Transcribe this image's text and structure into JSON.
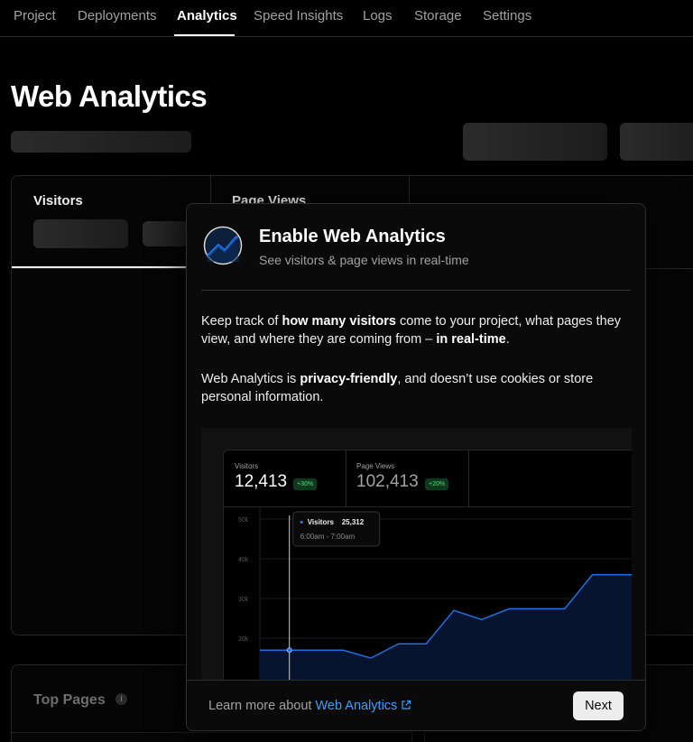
{
  "nav": {
    "tabs": [
      {
        "label": "Project"
      },
      {
        "label": "Deployments"
      },
      {
        "label": "Analytics"
      },
      {
        "label": "Speed Insights"
      },
      {
        "label": "Logs"
      },
      {
        "label": "Storage"
      },
      {
        "label": "Settings"
      }
    ],
    "active": "Analytics"
  },
  "page": {
    "title": "Web Analytics"
  },
  "stats": {
    "visitors_label": "Visitors",
    "pageviews_label": "Page Views"
  },
  "top_pages": {
    "title": "Top Pages",
    "info_glyph": "i"
  },
  "modal": {
    "title": "Enable Web Analytics",
    "subtitle": "See visitors & page views in real-time",
    "p1_a": "Keep track of ",
    "p1_b": "how many visitors",
    "p1_c": " come to your project, what pages they view, and where they are coming from – ",
    "p1_d": "in real-time",
    "p1_e": ".",
    "p2_a": "Web Analytics is ",
    "p2_b": "privacy-friendly",
    "p2_c": ", and doesn’t use cookies or store personal information.",
    "learn_prefix": "Learn more about ",
    "learn_link": "Web Analytics",
    "next_label": "Next",
    "accent": "#3b9eff"
  },
  "preview": {
    "visitors_label": "Visitors",
    "visitors_value": "12,413",
    "visitors_change": "+30%",
    "pageviews_label": "Page Views",
    "pageviews_value": "102,413",
    "pageviews_change": "+20%",
    "tooltip_series": "Visitors",
    "tooltip_value": "25,312",
    "tooltip_time": "6:00am - 7:00am",
    "line_color": "#1f6fe5"
  },
  "chart_data": {
    "type": "area",
    "title": "",
    "xlabel": "",
    "ylabel": "",
    "y_ticks": [
      "50k",
      "40k",
      "30k",
      "20k"
    ],
    "ylim": [
      10000,
      50000
    ],
    "series": [
      {
        "name": "Visitors",
        "values": [
          17000,
          17000,
          17000,
          17000,
          15000,
          18600,
          18600,
          27000,
          24700,
          27400,
          27400,
          27400,
          36000,
          36000,
          36000
        ]
      }
    ],
    "grid": true
  }
}
